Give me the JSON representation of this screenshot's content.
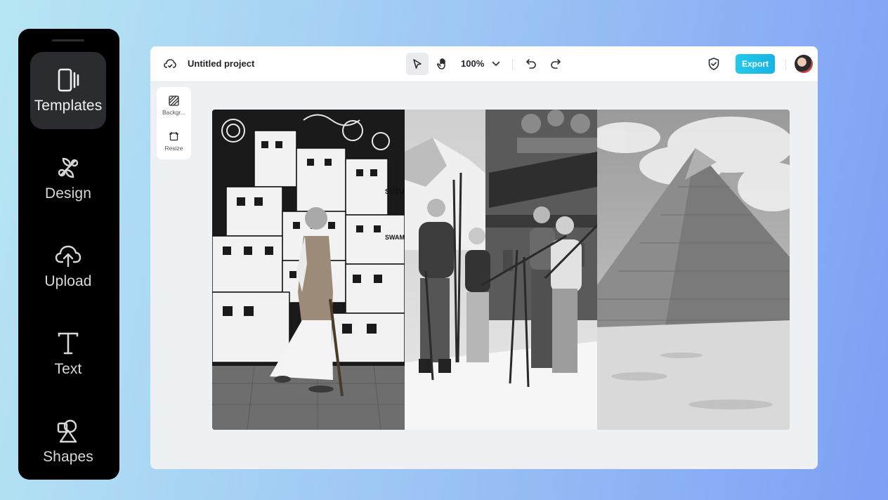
{
  "sidebar": {
    "items": [
      {
        "label": "Templates",
        "icon": "templates-icon",
        "active": true
      },
      {
        "label": "Design",
        "icon": "design-icon"
      },
      {
        "label": "Upload",
        "icon": "upload-cloud-icon"
      },
      {
        "label": "Text",
        "icon": "text-icon"
      },
      {
        "label": "Shapes",
        "icon": "shapes-icon"
      }
    ]
  },
  "topbar": {
    "project_title": "Untitled project",
    "zoom": "100%",
    "export_label": "Export"
  },
  "side_panel": {
    "items": [
      {
        "label": "Backgr...",
        "icon": "background-icon"
      },
      {
        "label": "Resize",
        "icon": "resize-icon"
      }
    ]
  },
  "canvas": {
    "images": [
      {
        "subject": "elderly man walking past black-and-white mural",
        "mural_text_1": "SUZU",
        "mural_text_2": "SWAM"
      },
      {
        "subject": "group of skiers in front of alpine chalet"
      },
      {
        "subject": "pyramid in desert under cloudy sky"
      }
    ]
  },
  "colors": {
    "sidebar_bg": "#000000",
    "export_accent": "#22c9e8"
  }
}
